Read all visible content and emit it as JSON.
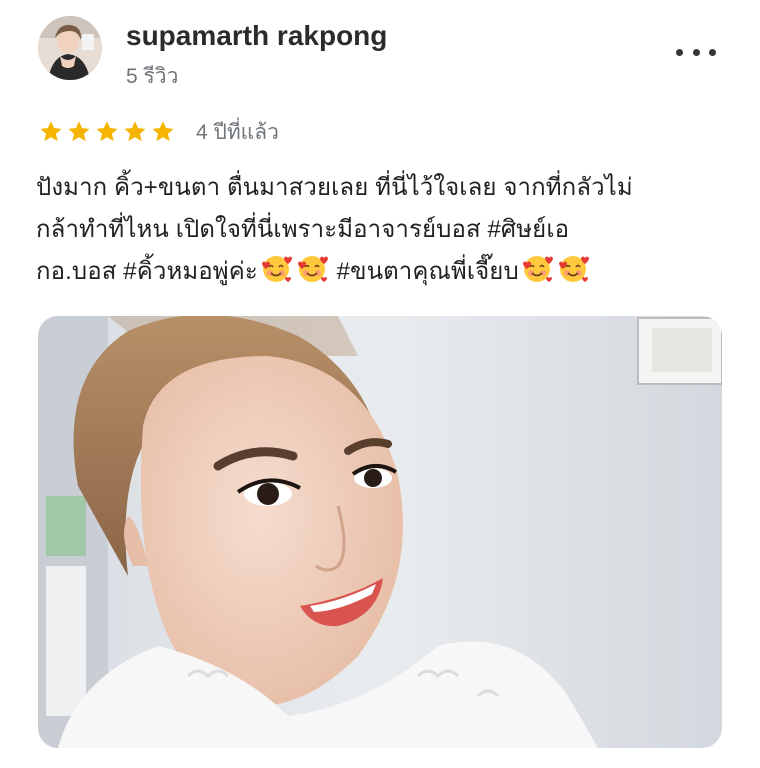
{
  "review": {
    "author_name": "supamarth rakpong",
    "author_review_count": "5 รีวิว",
    "rating": 5,
    "rating_max": 5,
    "date": "4 ปีที่แล้ว",
    "text_lines": [
      "ปังมาก คิ้ว+ขนตา ตื่นมาสวยเลย ที่นี่ไว้ใจเลย จากที่กลัวไม่",
      "กล้าทำที่ไหน เปิดใจที่นี่เพราะมีอาจารย์บอส #ศิษย์เอ",
      "กอ.บอส #คิ้วหมอพู่ค่ะ",
      " #ขนตาคุณพี่เจี๊ยบ"
    ],
    "emoji_name": "smiling-face-with-hearts",
    "more_icon": "more-horizontal-icon",
    "star_color": "#f5b400"
  }
}
